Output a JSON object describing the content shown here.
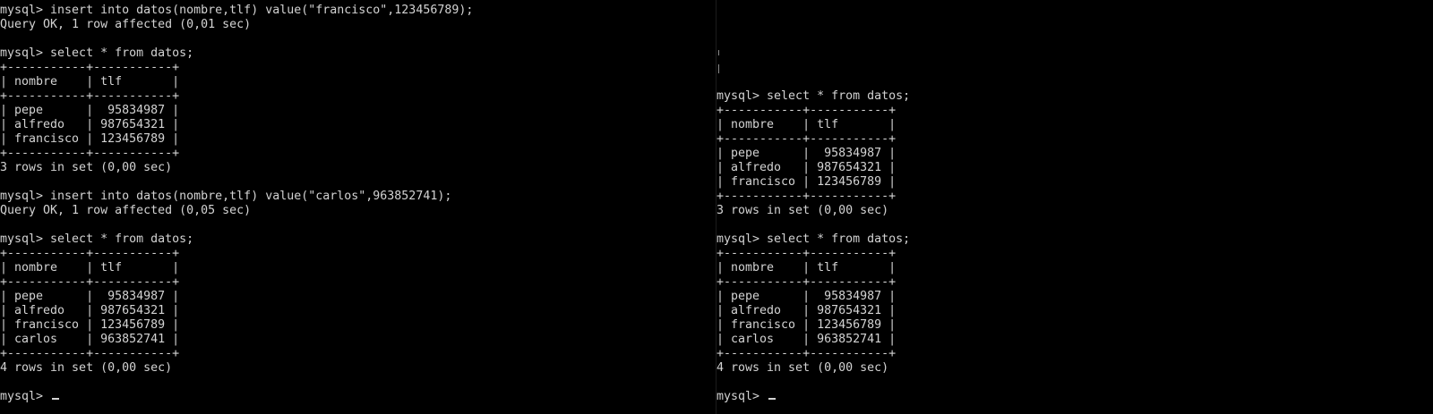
{
  "colors": {
    "background": "#000000",
    "foreground": "#d3d3d3"
  },
  "left_terminal": {
    "text": "mysql> insert into datos(nombre,tlf) value(\"francisco\",123456789);\nQuery OK, 1 row affected (0,01 sec)\n\nmysql> select * from datos;\n+-----------+-----------+\n| nombre    | tlf       |\n+-----------+-----------+\n| pepe      |  95834987 |\n| alfredo   | 987654321 |\n| francisco | 123456789 |\n+-----------+-----------+\n3 rows in set (0,00 sec)\n\nmysql> insert into datos(nombre,tlf) value(\"carlos\",963852741);\nQuery OK, 1 row affected (0,05 sec)\n\nmysql> select * from datos;\n+-----------+-----------+\n| nombre    | tlf       |\n+-----------+-----------+\n| pepe      |  95834987 |\n| alfredo   | 987654321 |\n| francisco | 123456789 |\n| carlos    | 963852741 |\n+-----------+-----------+\n4 rows in set (0,00 sec)\n\nmysql> ",
    "cursor": "_"
  },
  "right_terminal": {
    "text": "mysql> select * from datos;\n+-----------+-----------+\n| nombre    | tlf       |\n+-----------+-----------+\n| pepe      |  95834987 |\n| alfredo   | 987654321 |\n| francisco | 123456789 |\n+-----------+-----------+\n3 rows in set (0,00 sec)\n\nmysql> select * from datos;\n+-----------+-----------+\n| nombre    | tlf       |\n+-----------+-----------+\n| pepe      |  95834987 |\n| alfredo   | 987654321 |\n| francisco | 123456789 |\n| carlos    | 963852741 |\n+-----------+-----------+\n4 rows in set (0,00 sec)\n\nmysql> ",
    "cursor": "_"
  }
}
